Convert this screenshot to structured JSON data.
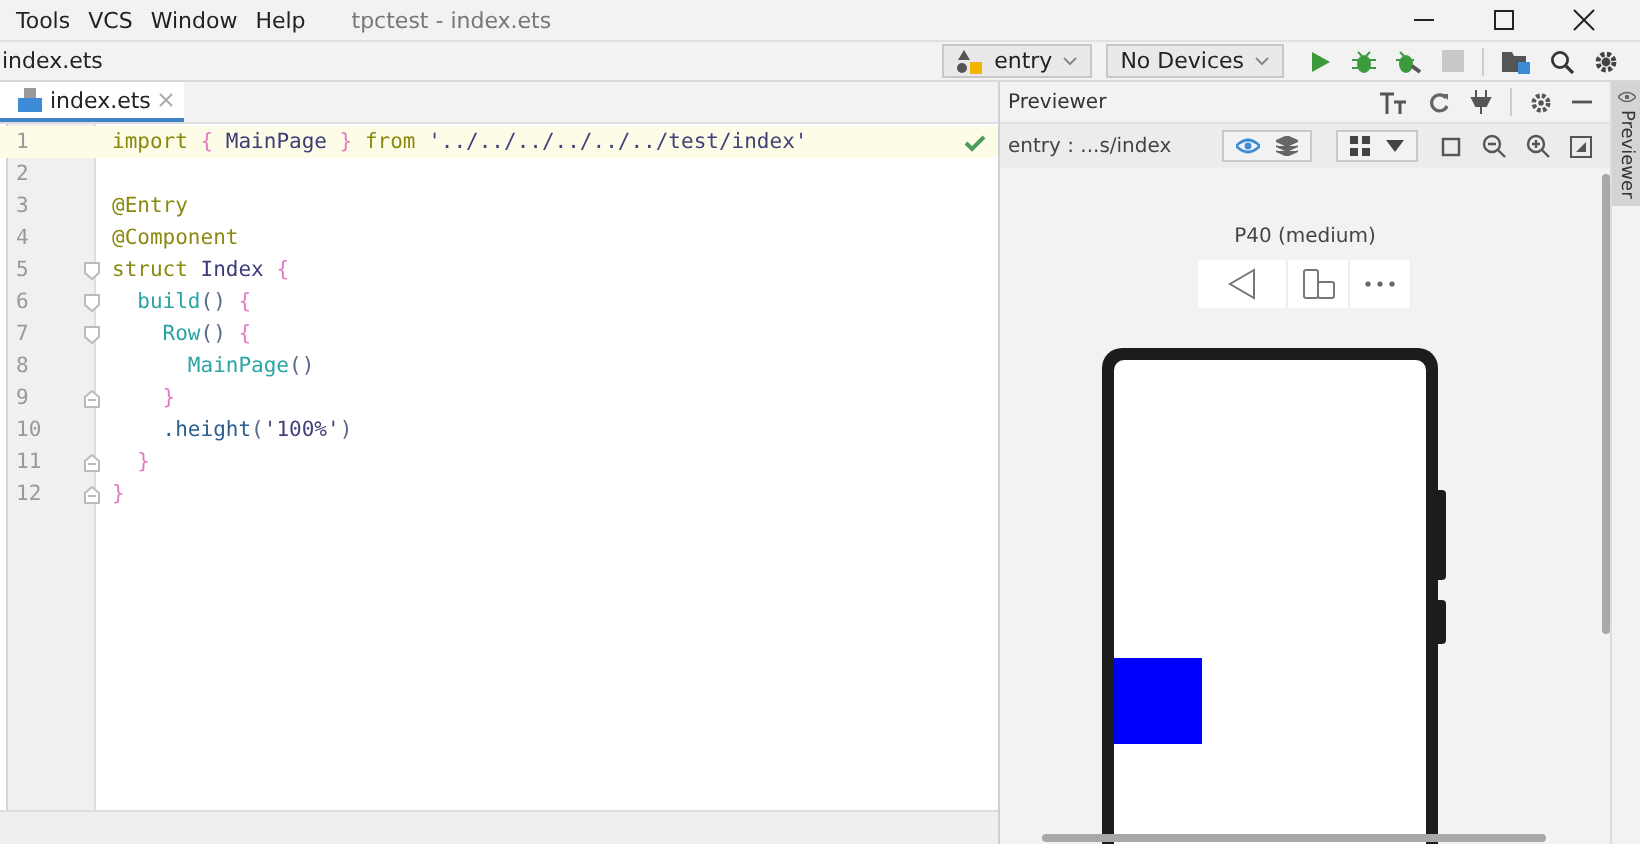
{
  "menu": [
    {
      "label": "Tools"
    },
    {
      "label": "VCS"
    },
    {
      "label": "Window"
    },
    {
      "label": "Help"
    }
  ],
  "window": {
    "title": "tpctest - index.ets"
  },
  "breadcrumb": "index.ets",
  "toolbar": {
    "module": "entry",
    "device": "No Devices"
  },
  "tabs": [
    {
      "label": "index.ets",
      "selected": true
    }
  ],
  "editor": {
    "valid": true,
    "lines": [
      {
        "number": "1",
        "current": true,
        "fold_start": false,
        "fold_end": false,
        "tokens": [
          {
            "kind": "keyword",
            "text": "import"
          },
          {
            "kind": "brace",
            "text": " { "
          },
          {
            "kind": "ident",
            "text": "MainPage"
          },
          {
            "kind": "brace",
            "text": " } "
          },
          {
            "kind": "keyword",
            "text": "from"
          },
          {
            "kind": "string",
            "text": " '../../../../../../test/index'"
          }
        ]
      },
      {
        "number": "2",
        "current": false,
        "fold_start": false,
        "fold_end": false
      },
      {
        "number": "3",
        "current": false,
        "fold_start": false,
        "fold_end": false,
        "tokens": [
          {
            "kind": "decorator",
            "text": "@Entry"
          }
        ]
      },
      {
        "number": "4",
        "current": false,
        "fold_start": false,
        "fold_end": false,
        "tokens": [
          {
            "kind": "decorator",
            "text": "@Component"
          }
        ]
      },
      {
        "number": "5",
        "current": false,
        "fold_start": true,
        "fold_end": false,
        "tokens": [
          {
            "kind": "keyword",
            "text": "struct"
          },
          {
            "kind": "ident",
            "text": " Index"
          },
          {
            "kind": "brace",
            "text": " {"
          }
        ]
      },
      {
        "number": "6",
        "current": false,
        "fold_start": true,
        "fold_end": false,
        "tokens": [
          {
            "kind": "call",
            "text": "  build"
          },
          {
            "kind": "paren",
            "text": "()"
          },
          {
            "kind": "brace",
            "text": " {"
          }
        ]
      },
      {
        "number": "7",
        "current": false,
        "fold_start": true,
        "fold_end": false,
        "tokens": [
          {
            "kind": "call",
            "text": "    Row"
          },
          {
            "kind": "paren",
            "text": "()"
          },
          {
            "kind": "brace",
            "text": " {"
          }
        ]
      },
      {
        "number": "8",
        "current": false,
        "fold_start": false,
        "fold_end": false,
        "tokens": [
          {
            "kind": "call",
            "text": "      MainPage"
          },
          {
            "kind": "paren",
            "text": "()"
          }
        ]
      },
      {
        "number": "9",
        "current": false,
        "fold_start": false,
        "fold_end": true,
        "tokens": [
          {
            "kind": "brace",
            "text": "    }"
          }
        ]
      },
      {
        "number": "10",
        "current": false,
        "fold_start": false,
        "fold_end": false,
        "tokens": [
          {
            "kind": "method",
            "text": "    .height"
          },
          {
            "kind": "paren",
            "text": "("
          },
          {
            "kind": "string",
            "text": "'100%'"
          },
          {
            "kind": "paren",
            "text": ")"
          }
        ]
      },
      {
        "number": "11",
        "current": false,
        "fold_start": false,
        "fold_end": true,
        "tokens": [
          {
            "kind": "brace",
            "text": "  }"
          }
        ]
      },
      {
        "number": "12",
        "current": false,
        "fold_start": false,
        "fold_end": true,
        "tokens": [
          {
            "kind": "brace",
            "text": "}"
          }
        ]
      }
    ]
  },
  "previewer": {
    "title": "Previewer",
    "path": "entry : ...s/index",
    "device_label": "P40 (medium)",
    "side_tab": "Previewer"
  }
}
